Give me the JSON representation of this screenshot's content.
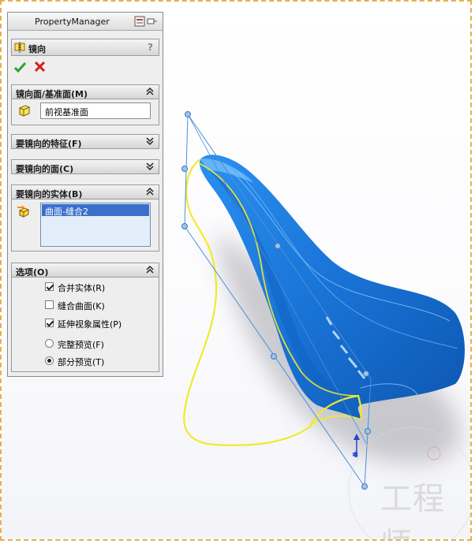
{
  "panel": {
    "title": "PropertyManager",
    "feature_name": "镜向",
    "help_glyph": "?",
    "ok_icon": "check-icon",
    "cancel_icon": "x-icon"
  },
  "sections": {
    "mirror_plane": {
      "title": "镜向面/基准面(M)",
      "value": "前视基准面"
    },
    "features": {
      "title": "要镜向的特征(F)"
    },
    "faces": {
      "title": "要镜向的面(C)"
    },
    "bodies": {
      "title": "要镜向的实体(B)",
      "items": [
        "曲面-缝合2"
      ]
    },
    "options": {
      "title": "选项(O)",
      "merge": "合并实体(R)",
      "knit": "缝合曲面(K)",
      "propagate": "延伸视象属性(P)",
      "full_preview": "完整预览(F)",
      "partial_preview": "部分预览(T)"
    }
  },
  "states": {
    "merge": true,
    "knit": false,
    "propagate": true,
    "preview": "partial"
  },
  "colors": {
    "surface": "#1e7fe0",
    "preview_curve": "#f2ea2a",
    "selection_list": "#cfe3f7"
  },
  "watermark": "工程师"
}
